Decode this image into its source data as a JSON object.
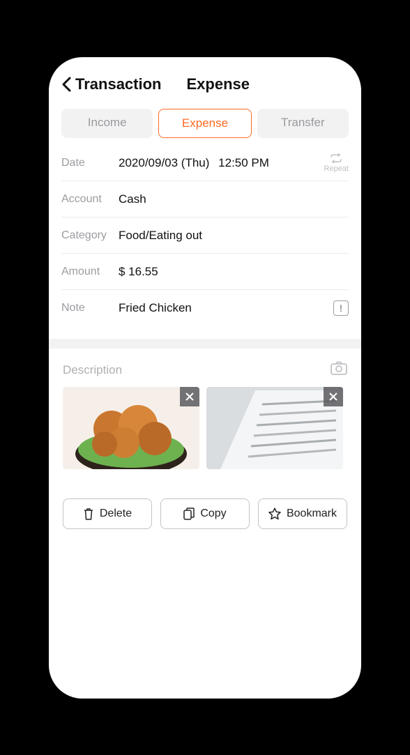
{
  "header": {
    "back_label": "Transaction",
    "page_title": "Expense"
  },
  "tabs": {
    "items": [
      {
        "label": "Income",
        "active": false
      },
      {
        "label": "Expense",
        "active": true
      },
      {
        "label": "Transfer",
        "active": false
      }
    ]
  },
  "fields": {
    "date": {
      "label": "Date",
      "value_date": "2020/09/03 (Thu)",
      "value_time": "12:50 PM",
      "repeat_label": "Repeat"
    },
    "account": {
      "label": "Account",
      "value": "Cash"
    },
    "category": {
      "label": "Category",
      "value": "Food/Eating out"
    },
    "amount": {
      "label": "Amount",
      "value": "$ 16.55"
    },
    "note": {
      "label": "Note",
      "value": "Fried Chicken"
    }
  },
  "description": {
    "label": "Description",
    "attachments": [
      {
        "name": "food-photo"
      },
      {
        "name": "receipt-photo"
      }
    ]
  },
  "actions": {
    "delete": "Delete",
    "copy": "Copy",
    "bookmark": "Bookmark"
  },
  "colors": {
    "accent": "#ff6a26"
  }
}
